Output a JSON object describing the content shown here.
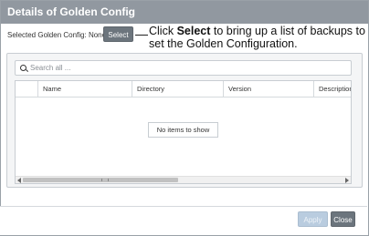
{
  "dialog": {
    "title": "Details of Golden Config"
  },
  "golden": {
    "label": "Selected Golden Config: None",
    "select_label": "Select"
  },
  "callout": {
    "prefix": "Click ",
    "bold": "Select",
    "rest": " to bring up a list of backups to set the Golden Configuration."
  },
  "search": {
    "placeholder": "Search all ..."
  },
  "table": {
    "columns": [
      "",
      "Name",
      "Directory",
      "Version",
      "Description"
    ],
    "empty_message": "No items to show"
  },
  "footer": {
    "apply_label": "Apply",
    "close_label": "Close"
  },
  "colors": {
    "titlebar": "#9198a0",
    "button": "#6c757d",
    "disabled_button": "#b9ccdf"
  }
}
